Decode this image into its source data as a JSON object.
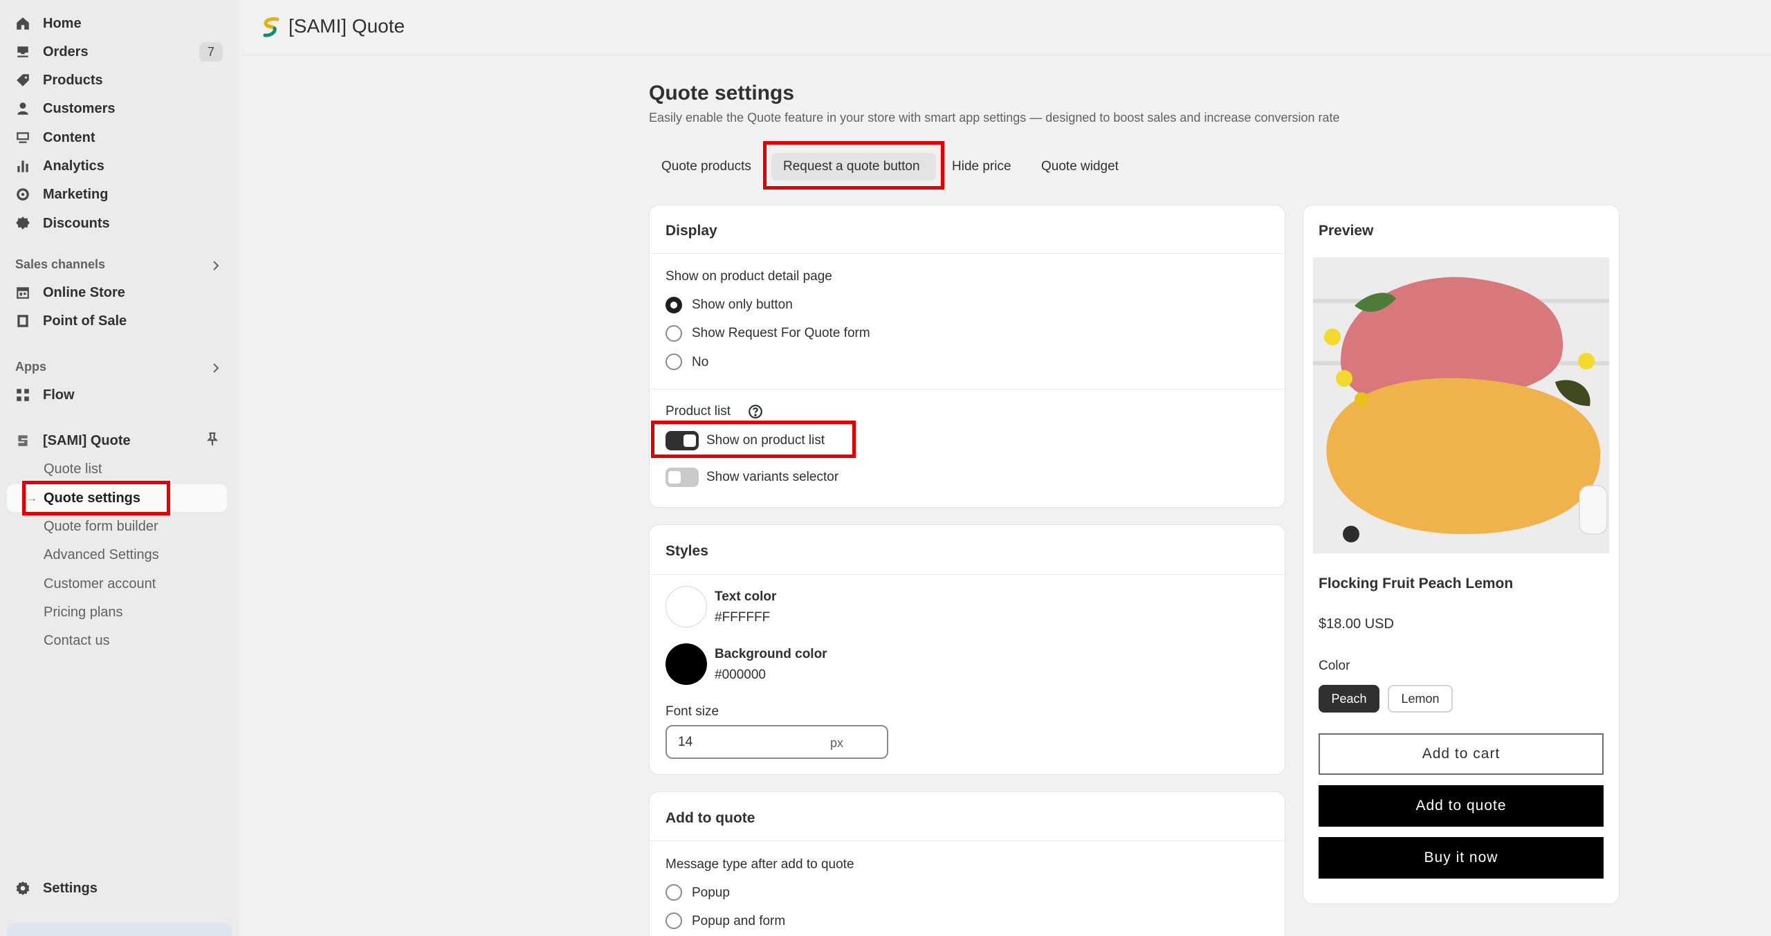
{
  "sidebar": {
    "nav": [
      {
        "label": "Home",
        "icon": "home-icon"
      },
      {
        "label": "Orders",
        "icon": "inbox-icon"
      },
      {
        "label": "Products",
        "icon": "tag-icon"
      },
      {
        "label": "Customers",
        "icon": "person-icon"
      },
      {
        "label": "Content",
        "icon": "content-icon"
      },
      {
        "label": "Analytics",
        "icon": "bar-chart-icon"
      },
      {
        "label": "Marketing",
        "icon": "target-icon"
      },
      {
        "label": "Discounts",
        "icon": "discount-icon"
      }
    ],
    "orders_badge": "7",
    "sales_channels_label": "Sales channels",
    "sales_channels": [
      {
        "label": "Online Store",
        "icon": "store-icon"
      },
      {
        "label": "Point of Sale",
        "icon": "pos-icon"
      }
    ],
    "apps_label": "Apps",
    "apps": [
      {
        "label": "Flow",
        "icon": "flow-icon"
      }
    ],
    "app_name": "[SAMI] Quote",
    "app_subitems": [
      "Quote list",
      "Quote settings",
      "Quote form builder",
      "Advanced Settings",
      "Customer account",
      "Pricing plans",
      "Contact us"
    ],
    "settings_label": "Settings"
  },
  "header": {
    "title": "[SAMI] Quote"
  },
  "page": {
    "title": "Quote settings",
    "subtitle": "Easily enable the Quote feature in your store with smart app settings — designed to boost sales and increase conversion rate",
    "tabs": [
      "Quote products",
      "Request a quote button",
      "Hide price",
      "Quote widget"
    ]
  },
  "display": {
    "title": "Display",
    "detail_label": "Show on product detail page",
    "options": [
      "Show only button",
      "Show Request For Quote form",
      "No"
    ],
    "product_list_label": "Product list",
    "toggle_product_list": "Show on product list",
    "toggle_variants": "Show variants selector"
  },
  "styles": {
    "title": "Styles",
    "text_color_label": "Text color",
    "text_color_value": "#FFFFFF",
    "bg_color_label": "Background color",
    "bg_color_value": "#000000",
    "font_size_label": "Font size",
    "font_size_value": "14",
    "font_size_unit": "px"
  },
  "add_to_quote": {
    "title": "Add to quote",
    "message_label": "Message type after add to quote",
    "options": [
      "Popup",
      "Popup and form"
    ]
  },
  "preview": {
    "title": "Preview",
    "product_name": "Flocking Fruit Peach Lemon",
    "price": "$18.00 USD",
    "color_label": "Color",
    "colors": [
      "Peach",
      "Lemon"
    ],
    "add_to_cart": "Add to cart",
    "add_to_quote": "Add to quote",
    "buy_now": "Buy it now"
  },
  "colors": {
    "highlight": "#e40000",
    "accent": "#000000",
    "sidebar_bg": "#ebebeb"
  }
}
